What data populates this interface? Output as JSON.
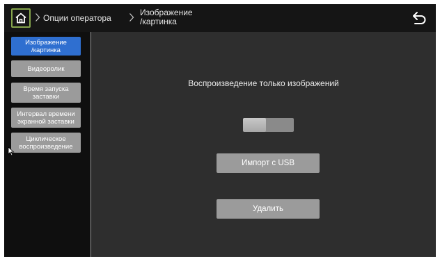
{
  "breadcrumb": {
    "level1": "Опции оператора",
    "level2": "Изображение\n/картинка"
  },
  "icons": {
    "home": "home-icon",
    "back": "back-arrow-icon",
    "separator": "chevron-right-icon"
  },
  "sidebar": {
    "items": [
      {
        "label": "Изображение\n/картинка",
        "active": true
      },
      {
        "label": "Видеоролик",
        "active": false
      },
      {
        "label": "Время запуска\nзаставки",
        "active": false
      },
      {
        "label": "Интервал времени\nэкранной заставки",
        "active": false
      },
      {
        "label": "Циклическое\nвоспроизведение",
        "active": false
      }
    ]
  },
  "main": {
    "mode_label": "Воспроизведение только изображений",
    "toggle_level": 0.45,
    "import_button": "Импорт с USB",
    "delete_button": "Удалить"
  },
  "colors": {
    "accent_blue": "#2f6fd0",
    "home_border": "#86a64c",
    "button_gray": "#9b9b9b",
    "panel_bg": "#2e2e2e"
  }
}
